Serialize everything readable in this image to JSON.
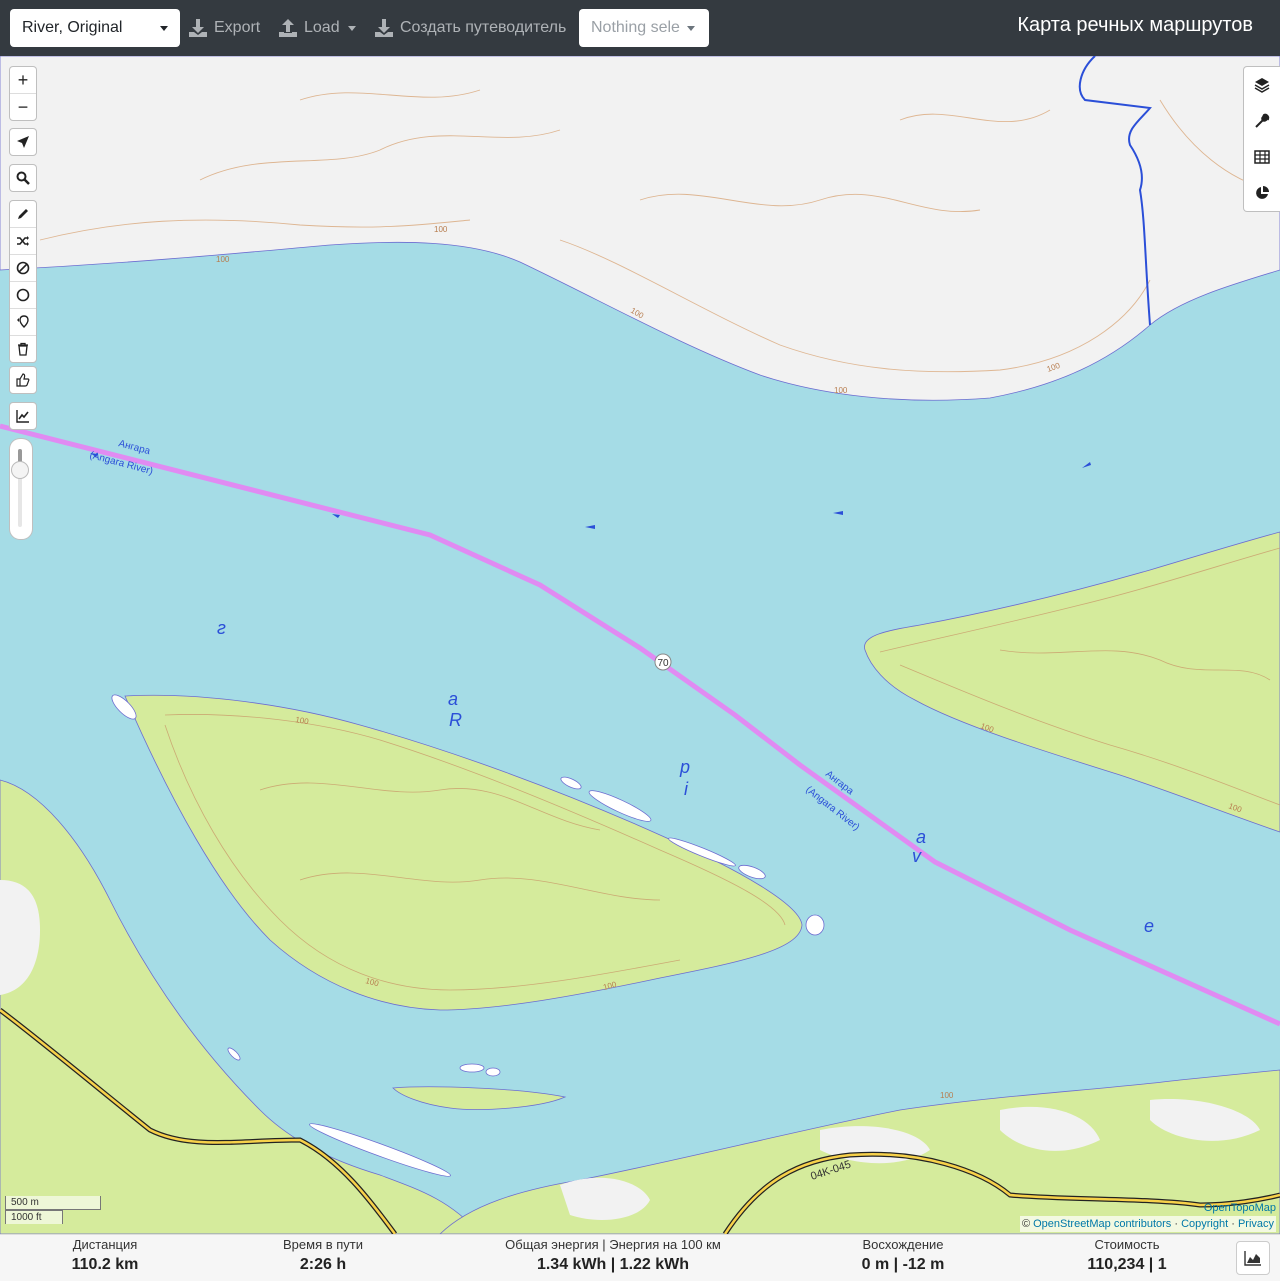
{
  "header": {
    "profile": "River, Original",
    "export_label": "Export",
    "load_label": "Load",
    "create_guide_label": "Создать путеводитель",
    "route_placeholder": "Nothing sele",
    "title": "Карта речных маршрутов"
  },
  "map": {
    "river_name": "Ангара",
    "river_name_en": "(Angara River)",
    "river_letters": [
      "г",
      "a",
      "R",
      "p",
      "i",
      "a",
      "v",
      "e"
    ],
    "route_badge": "70",
    "contour_label": "100",
    "road_label": "04K-045",
    "route_color": "#e08bf2",
    "water_color": "#a5dce6",
    "island_color": "#d5eb9c",
    "land_color": "#f2f2f2"
  },
  "zoom_controls": {
    "zoom_in": "+",
    "zoom_out": "−"
  },
  "left_toolbar_icons": [
    "locate-icon",
    "search-icon",
    "pencil-icon",
    "shuffle-icon",
    "no-entry-icon",
    "circle-icon",
    "pin-icon",
    "trash-icon",
    "thumbs-icon",
    "chart-line-icon"
  ],
  "right_toolbar_icons": [
    "layers-icon",
    "wrench-icon",
    "table-icon",
    "pie-chart-icon"
  ],
  "scale": {
    "metric": "500 m",
    "imperial": "1000 ft"
  },
  "attribution": {
    "provider": "OpenTopoMap",
    "copyright_symbol": "©",
    "osm": "OpenStreetMap contributors",
    "copyright": "Copyright",
    "privacy": "Privacy"
  },
  "stats": {
    "distance_label": "Дистанция",
    "distance_value": "110.2 km",
    "time_label": "Время в пути",
    "time_value": "2:26 h",
    "energy_label": "Общая энергия | Энергия на 100 км",
    "energy_value": "1.34 kWh | 1.22 kWh",
    "ascent_label": "Восхождение",
    "ascent_value": "0 m | -12 m",
    "cost_label": "Стоимость",
    "cost_value": "110,234 | 1"
  }
}
